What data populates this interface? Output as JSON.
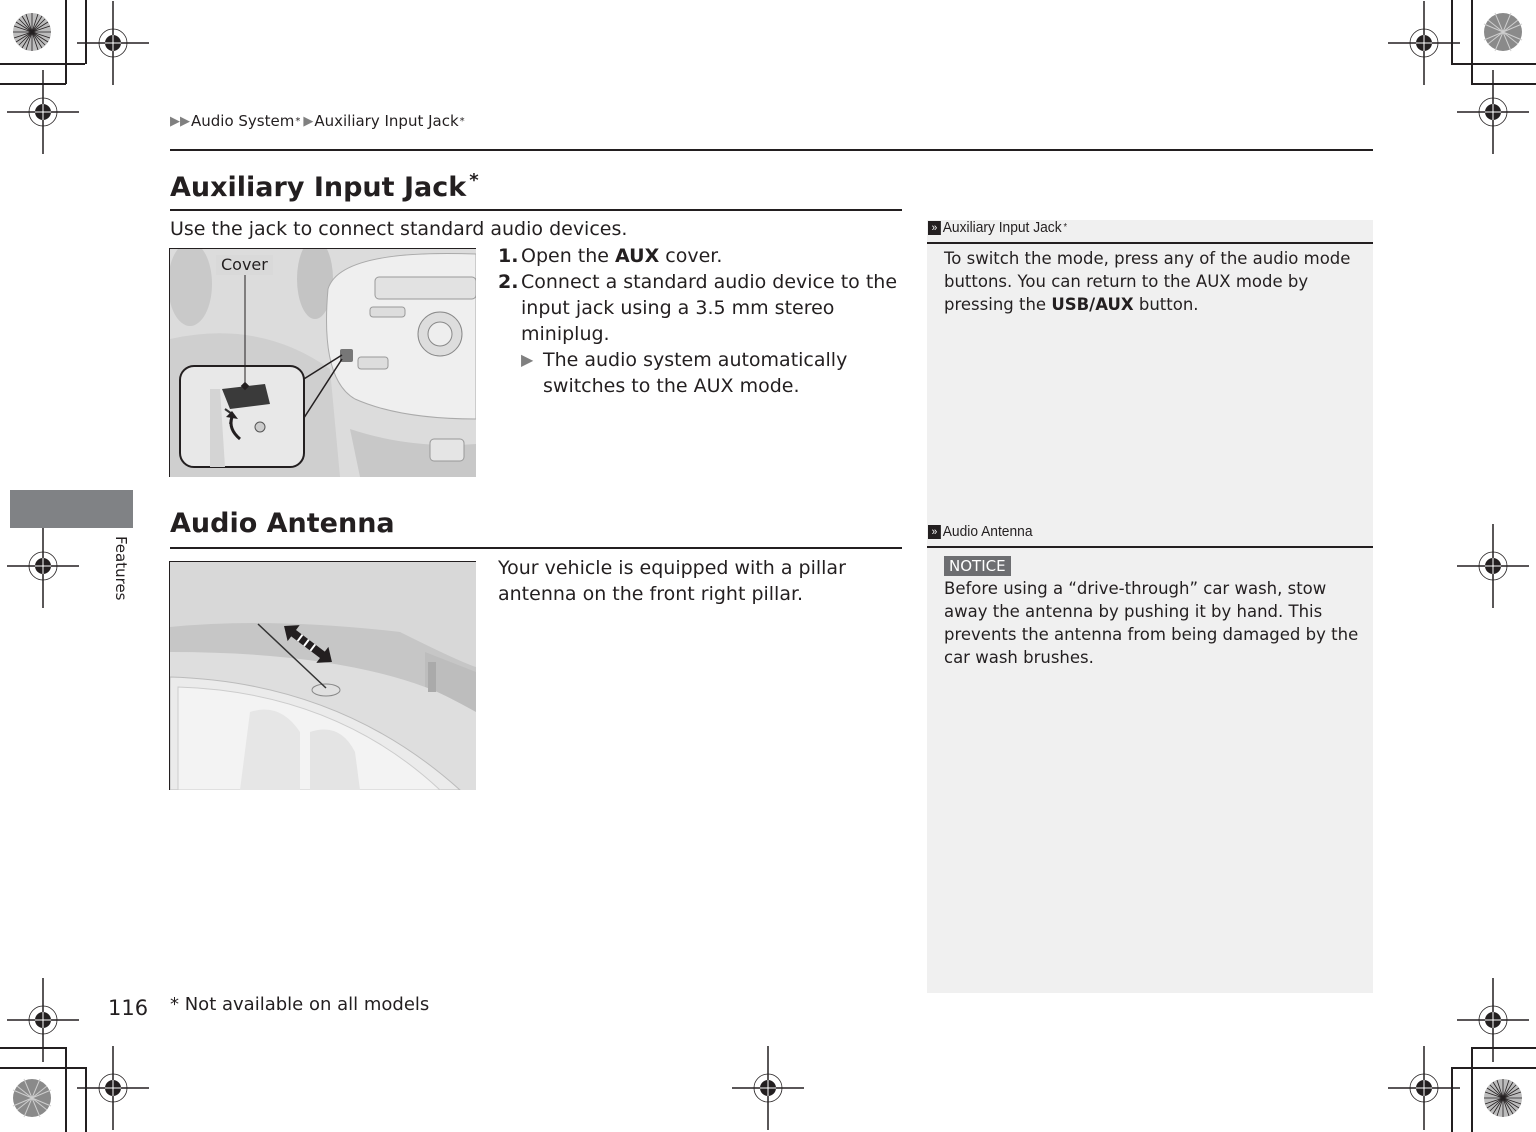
{
  "breadcrumb": {
    "items": [
      {
        "label": "Audio System",
        "starred": true
      },
      {
        "label": "Auxiliary Input Jack",
        "starred": true
      }
    ],
    "star": "*"
  },
  "sections": [
    {
      "heading": "Auxiliary Input Jack",
      "heading_star": "*",
      "intro": "Use the jack to connect standard audio devices.",
      "figure_label": "Cover",
      "steps": [
        {
          "num": "1.",
          "pre": "Open the ",
          "bold": "AUX",
          "post": " cover."
        },
        {
          "num": "2.",
          "text": "Connect a standard audio device to the input jack using a 3.5 mm stereo miniplug."
        }
      ],
      "sub_note": "The audio system automatically switches to the AUX mode."
    },
    {
      "heading": "Audio Antenna",
      "body": "Your vehicle is equipped with a pillar antenna on the front right pillar."
    }
  ],
  "notes": [
    {
      "title": "Auxiliary Input Jack",
      "title_star": "*",
      "text_pre": "To switch the mode, press any of the audio mode buttons. You can return to the AUX mode by pressing the ",
      "text_bold": "USB/AUX",
      "text_post": " button."
    },
    {
      "title": "Audio Antenna",
      "notice_label": "NOTICE",
      "text": "Before using a “drive-through” car wash, stow away the antenna by pushing it by hand. This prevents the antenna from being damaged by the car wash brushes."
    }
  ],
  "side_tab": "Features",
  "page_number": "116",
  "footnote": "* Not available on all models",
  "colors": {
    "text": "#231f20",
    "note_bg": "#f0f0f0",
    "tab_bg": "#808285",
    "notice_bg": "#6d6e71",
    "arrow": "#808080"
  }
}
